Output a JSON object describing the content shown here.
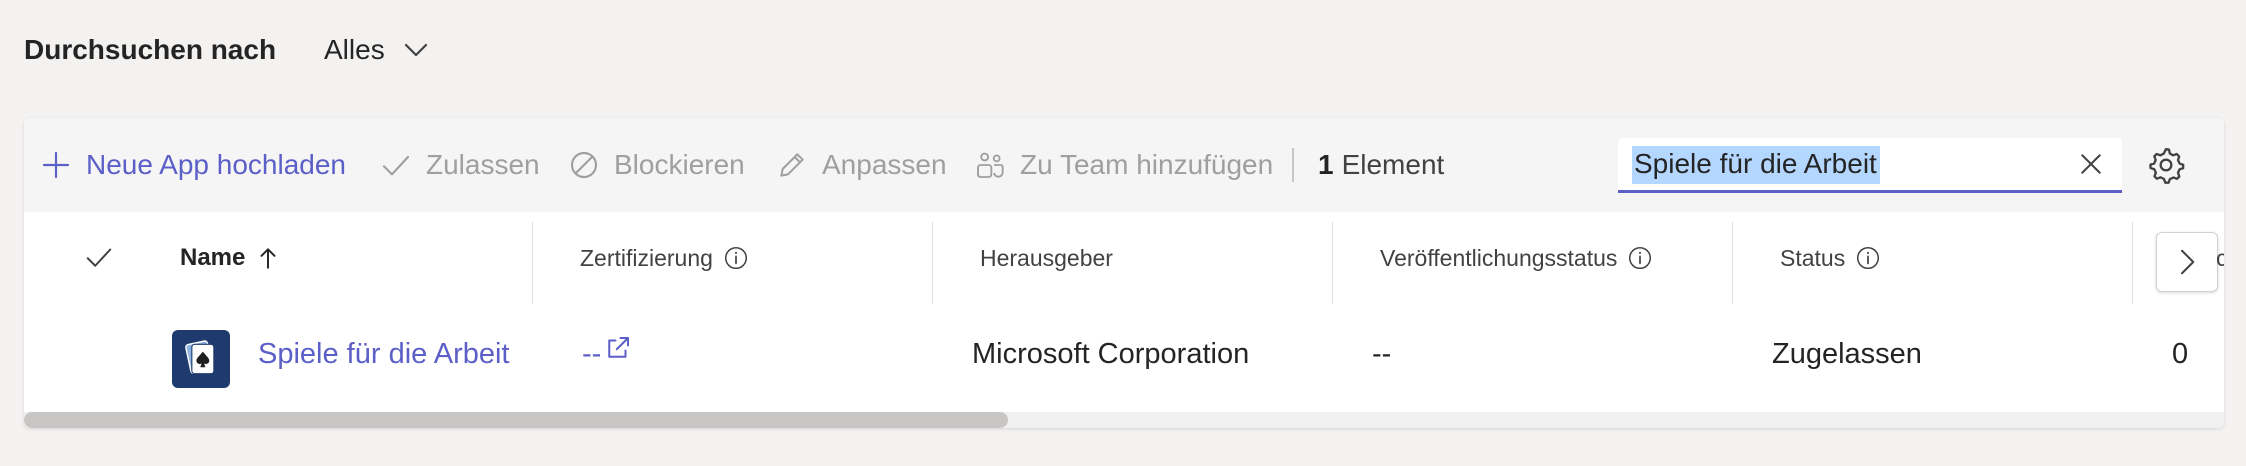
{
  "filter": {
    "label": "Durchsuchen nach",
    "selected": "Alles"
  },
  "toolbar": {
    "upload_label": "Neue App hochladen",
    "allow_label": "Zulassen",
    "block_label": "Blockieren",
    "customize_label": "Anpassen",
    "add_team_label": "Zu Team hinzufügen",
    "count_number": "1",
    "count_label": "Element"
  },
  "search": {
    "value": "Spiele für die Arbeit"
  },
  "table": {
    "columns": {
      "name": "Name",
      "certification": "Zertifizierung",
      "publisher": "Herausgeber",
      "publishing_status": "Veröffentlichungsstatus",
      "status": "Status",
      "next_cut": "c"
    },
    "rows": [
      {
        "name": "Spiele für die Arbeit",
        "certification": "--",
        "publisher": "Microsoft Corporation",
        "publishing_status": "--",
        "status": "Zugelassen",
        "last": "0"
      }
    ]
  },
  "colors": {
    "accent": "#5b5fc7",
    "disabled": "#a19f9d",
    "background": "#f3f2f1",
    "app_icon_bg": "#1e3a6e",
    "selection": "#b4d7ff"
  },
  "icons": {
    "upload": "plus-icon",
    "allow": "checkmark-icon",
    "block": "block-icon",
    "customize": "pencil-icon",
    "add_team": "people-team-icon",
    "clear": "close-icon",
    "settings": "gear-icon",
    "sort": "arrow-up-icon",
    "info": "info-icon",
    "scroll": "chevron-right-icon",
    "external": "external-link-icon"
  }
}
